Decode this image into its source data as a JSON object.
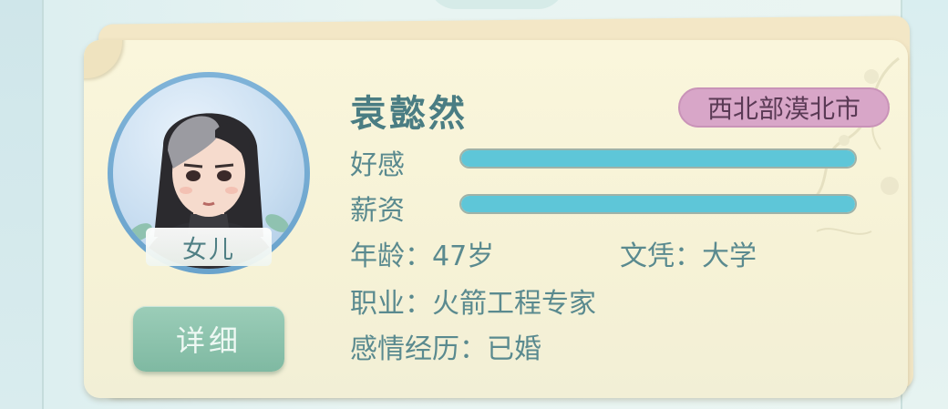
{
  "character": {
    "name": "袁懿然",
    "region": "西北部漠北市",
    "relation": "女儿",
    "detail_button_label": "详细"
  },
  "stats": {
    "affection": {
      "label": "好感",
      "level": 1.0
    },
    "salary": {
      "label": "薪资",
      "level": 1.0
    }
  },
  "info": {
    "age": "年龄：47岁",
    "education": "文凭：大学",
    "occupation": "职业：火箭工程专家",
    "relationship": "感情经历：已婚"
  },
  "colors": {
    "bar_fill": "#5ec6d8",
    "badge_bg": "#d8a6c8",
    "button_bg": "#8ec3ad",
    "text": "#5a8a8f"
  }
}
